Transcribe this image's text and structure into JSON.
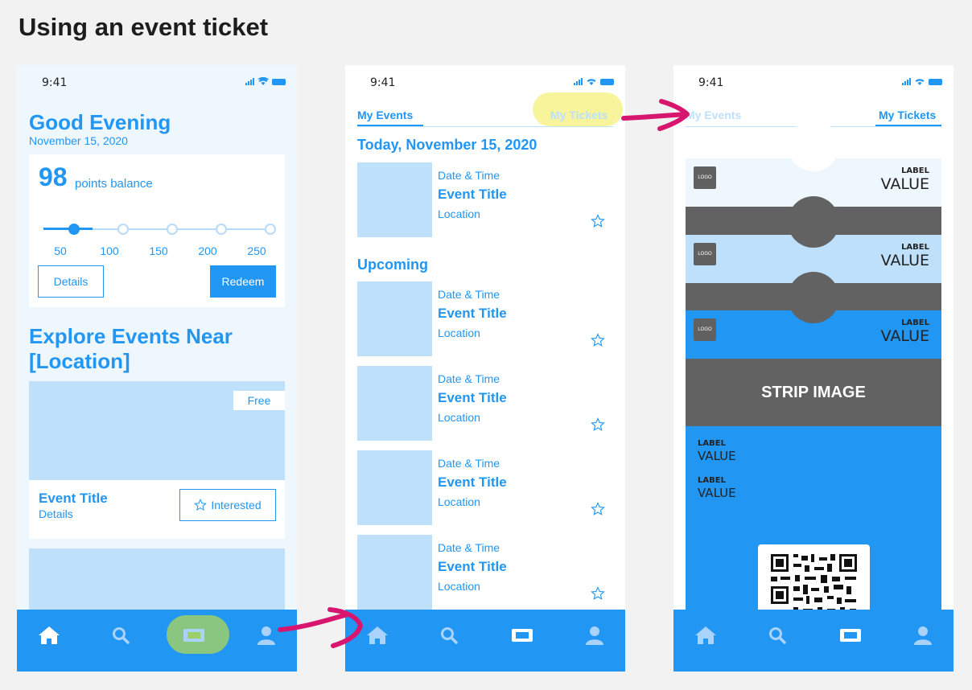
{
  "page_title": "Using an event ticket",
  "status_time": "9:41",
  "phone1": {
    "greeting": "Good Evening",
    "date": "November 15, 2020",
    "points": "98",
    "points_label": "points balance",
    "slider_ticks": [
      "50",
      "100",
      "150",
      "200",
      "250"
    ],
    "slider_value_fraction": 0,
    "details_button": "Details",
    "redeem_button": "Redeem",
    "explore_heading": "Explore Events Near [Location]",
    "event_card": {
      "price_tag": "Free",
      "title": "Event Title",
      "details": "Details",
      "interested_button": "Interested"
    }
  },
  "phone2": {
    "tab_events": "My Events",
    "tab_tickets": "My Tickets",
    "today_heading": "Today, November 15, 2020",
    "upcoming_heading": "Upcoming",
    "today_item": {
      "datetime": "Date & Time",
      "title": "Event Title",
      "location": "Location"
    },
    "upcoming_items": [
      {
        "datetime": "Date & Time",
        "title": "Event Title",
        "location": "Location"
      },
      {
        "datetime": "Date & Time",
        "title": "Event Title",
        "location": "Location"
      },
      {
        "datetime": "Date & Time",
        "title": "Event Title",
        "location": "Location"
      },
      {
        "datetime": "Date & Time",
        "title": "Event Title",
        "location": "Location"
      }
    ]
  },
  "phone3": {
    "tab_events": "My Events",
    "tab_tickets": "My Tickets",
    "ticket_logo": "LOGO",
    "ticket_label": "LABEL",
    "ticket_value": "VALUE",
    "strip_text_1": "STRIP IMAGE",
    "strip_text_2": "STRIP IMAGE",
    "strip_text_3": "STRIP IMAGE",
    "fields": [
      {
        "label": "LABEL",
        "value": "VALUE"
      },
      {
        "label": "LABEL",
        "value": "VALUE"
      }
    ]
  },
  "colors": {
    "accent": "#2196f3",
    "light_blue": "#bfe0fb",
    "pale_bg": "#eef6fe",
    "strip_gray": "#626262",
    "annotation_magenta": "#d6166f",
    "highlight_yellow": "#f5f07a",
    "highlight_green": "#9ccf6a"
  },
  "icons": [
    "home-icon",
    "search-icon",
    "ticket-icon",
    "profile-icon",
    "star-icon",
    "signal-icon",
    "wifi-icon",
    "battery-icon",
    "qr-code-icon"
  ]
}
